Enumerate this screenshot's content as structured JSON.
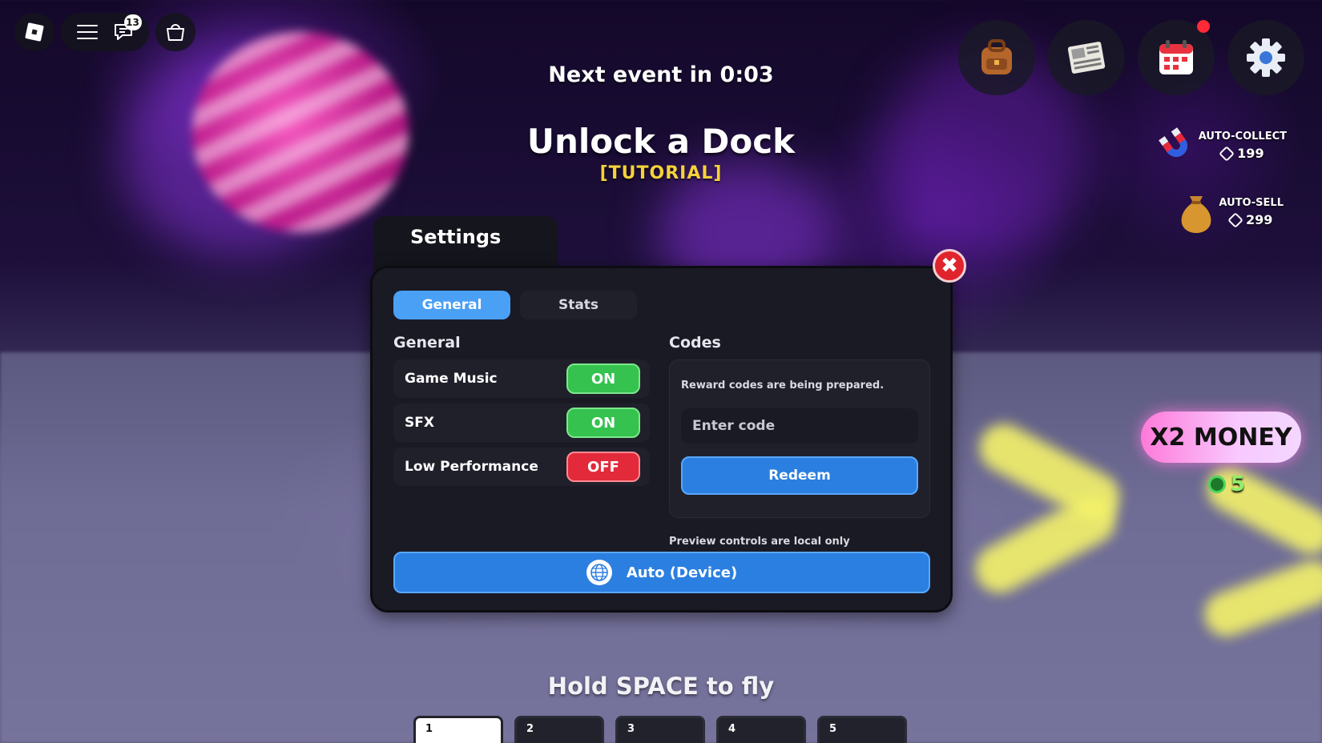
{
  "hud": {
    "chat_badge": "13",
    "event_timer": "Next event in 0:03",
    "objective_title": "Unlock a Dock",
    "objective_subtitle": "[TUTORIAL]",
    "fly_hint": "Hold SPACE to fly"
  },
  "top_right_icons": [
    "backpack-icon",
    "newspaper-icon",
    "calendar-icon",
    "gear-icon"
  ],
  "perks": {
    "auto_collect": {
      "label": "AUTO-COLLECT",
      "price": "199"
    },
    "auto_sell": {
      "label": "AUTO-SELL",
      "price": "299"
    }
  },
  "boost": {
    "label": "X2 MONEY",
    "price": "5"
  },
  "settings": {
    "title": "Settings",
    "tabs": [
      {
        "label": "General",
        "active": true
      },
      {
        "label": "Stats",
        "active": false
      }
    ],
    "general_heading": "General",
    "rows": [
      {
        "label": "Game Music",
        "state": "ON"
      },
      {
        "label": "SFX",
        "state": "ON"
      },
      {
        "label": "Low Performance",
        "state": "OFF"
      }
    ],
    "codes": {
      "heading": "Codes",
      "message": "Reward codes are being prepared.",
      "placeholder": "Enter code",
      "redeem_label": "Redeem"
    },
    "preview_note": "Preview controls are local only",
    "device_label": "Auto (Device)"
  },
  "hotbar": [
    "1",
    "2",
    "3",
    "4",
    "5"
  ],
  "colors": {
    "accent_blue": "#2b7fe0",
    "on_green": "#35c24f",
    "off_red": "#e32a3a",
    "tutorial_yellow": "#f5d23a"
  }
}
